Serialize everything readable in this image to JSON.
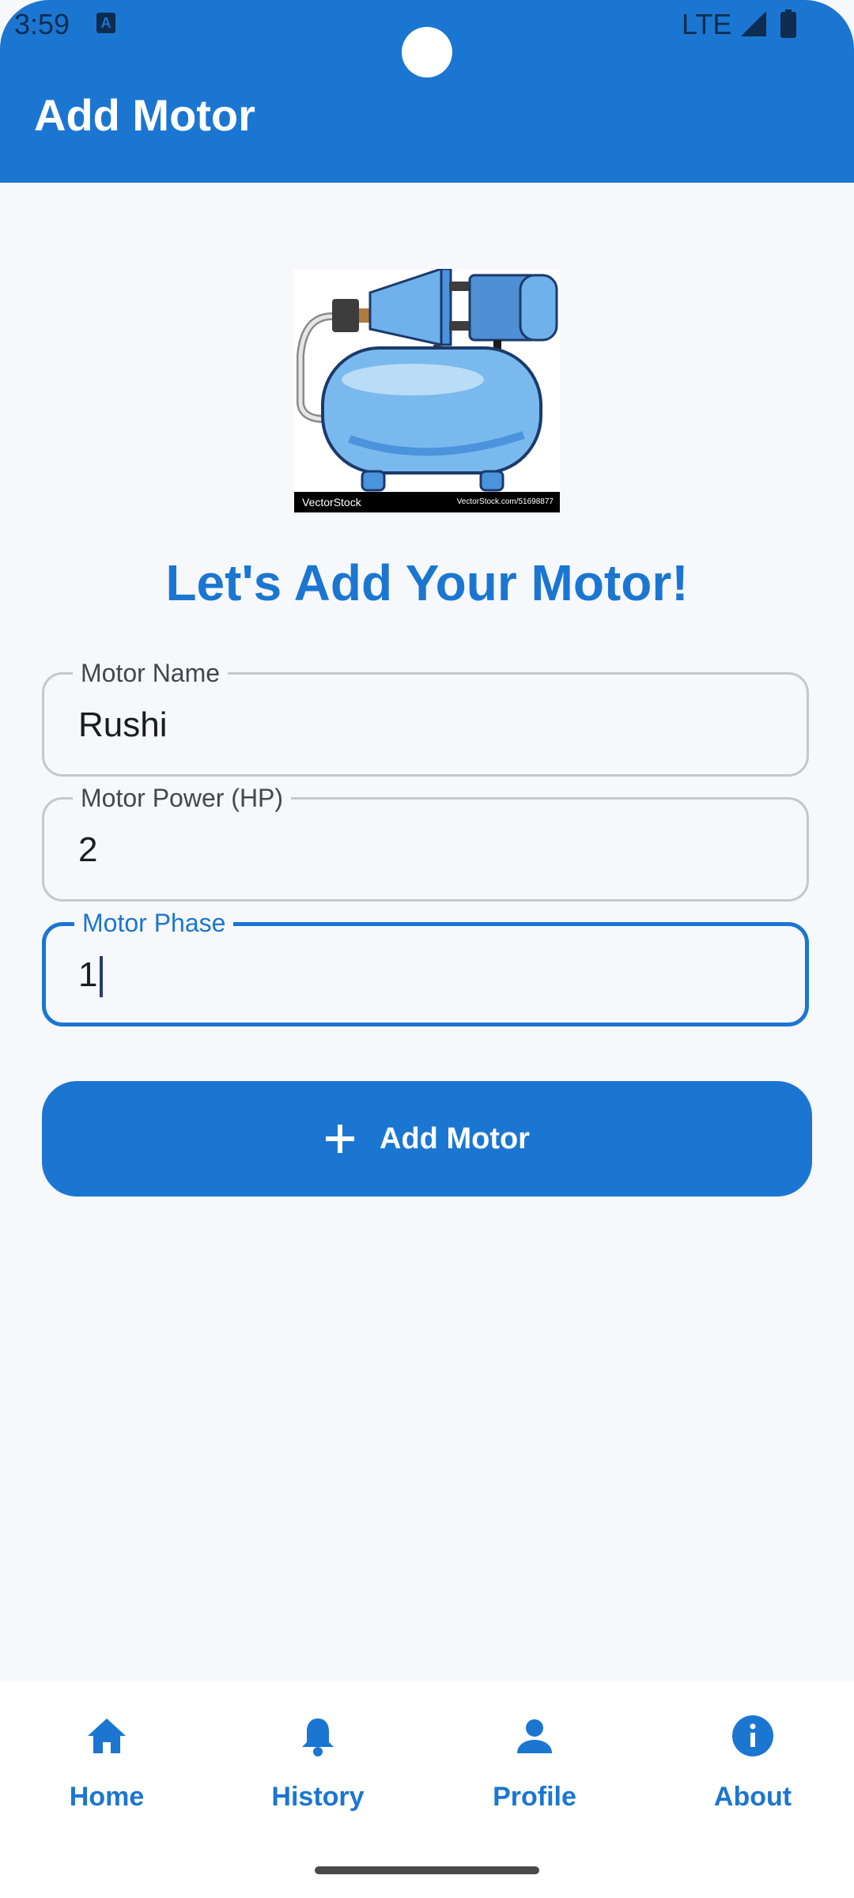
{
  "status_bar": {
    "time": "3:59",
    "network": "LTE"
  },
  "app_bar": {
    "title": "Add Motor"
  },
  "hero_image": {
    "watermark_left": "VectorStock",
    "watermark_right": "VectorStock.com/51698877"
  },
  "headline": "Let's Add Your Motor!",
  "form": {
    "name_label": "Motor Name",
    "name_value": "Rushi",
    "power_label": "Motor Power (HP)",
    "power_value": "2",
    "phase_label": "Motor Phase",
    "phase_value": "1"
  },
  "add_button": {
    "label": "Add Motor",
    "icon": "plus-icon"
  },
  "bottom_nav": {
    "items": [
      {
        "label": "Home",
        "icon": "home-icon"
      },
      {
        "label": "History",
        "icon": "bell-icon"
      },
      {
        "label": "Profile",
        "icon": "person-icon"
      },
      {
        "label": "About",
        "icon": "info-icon"
      }
    ]
  },
  "colors": {
    "primary": "#1b76d2",
    "background": "#f6f8fb"
  }
}
